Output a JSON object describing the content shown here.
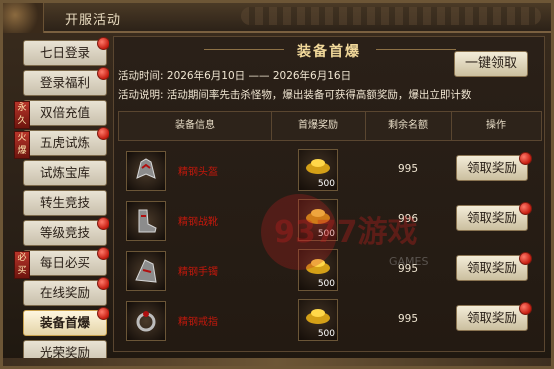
{
  "window": {
    "title": "开服活动"
  },
  "sidebar": {
    "items": [
      {
        "label": "七日登录",
        "badge": true,
        "tag": ""
      },
      {
        "label": "登录福利",
        "badge": true,
        "tag": ""
      },
      {
        "label": "双倍充值",
        "badge": false,
        "tag": "永久"
      },
      {
        "label": "五虎试炼",
        "badge": true,
        "tag": "火爆"
      },
      {
        "label": "试炼宝库",
        "badge": false,
        "tag": ""
      },
      {
        "label": "转生竞技",
        "badge": false,
        "tag": ""
      },
      {
        "label": "等级竞技",
        "badge": true,
        "tag": ""
      },
      {
        "label": "每日必买",
        "badge": true,
        "tag": "必买"
      },
      {
        "label": "在线奖励",
        "badge": true,
        "tag": ""
      },
      {
        "label": "装备首爆",
        "badge": true,
        "tag": "",
        "active": true
      },
      {
        "label": "光荣奖励",
        "badge": false,
        "tag": ""
      }
    ]
  },
  "panel": {
    "title": "装备首爆",
    "time_label": "活动时间:",
    "time_value": "2026年6月10日 —— 2026年6月16日",
    "desc_label": "活动说明:",
    "desc_value": "活动期间率先击杀怪物，爆出装备可获得高额奖励，爆出立即计数",
    "one_key_claim": "一键领取"
  },
  "table": {
    "headers": [
      "装备信息",
      "首爆奖励",
      "剩余名额",
      "操作"
    ],
    "rows": [
      {
        "item_name": "精钢头盔",
        "reward_count": "500",
        "remaining": "995",
        "action": "领取奖励"
      },
      {
        "item_name": "精钢战靴",
        "reward_count": "500",
        "remaining": "996",
        "action": "领取奖励"
      },
      {
        "item_name": "精钢手镯",
        "reward_count": "500",
        "remaining": "995",
        "action": "领取奖励"
      },
      {
        "item_name": "精钢戒指",
        "reward_count": "500",
        "remaining": "995",
        "action": "领取奖励"
      }
    ]
  },
  "watermark": {
    "text": "9377游戏",
    "sub": "GAMES"
  },
  "colors": {
    "accent_red": "#c51c10",
    "gold_title": "#f1d89a",
    "item_name_red": "#c3180c"
  }
}
